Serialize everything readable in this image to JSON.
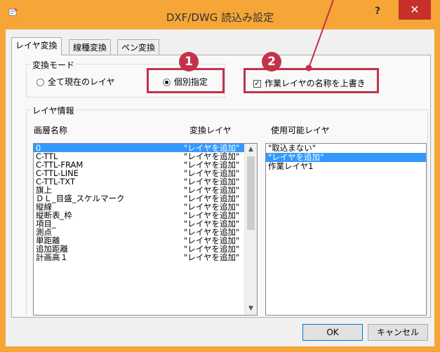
{
  "window": {
    "title": "DXF/DWG 読込み設定",
    "help_label": "?",
    "close_label": "✕",
    "accent_color": "#f5a637"
  },
  "tabs": [
    {
      "label": "レイヤ変換",
      "active": true
    },
    {
      "label": "線種変換",
      "active": false
    },
    {
      "label": "ペン変換",
      "active": false
    }
  ],
  "conversion_mode": {
    "title": "変換モード",
    "options": [
      {
        "label": "全て現在のレイヤ",
        "checked": false
      },
      {
        "label": "個別指定",
        "checked": true
      }
    ]
  },
  "overwrite_option": {
    "label": "作業レイヤの名称を上書き",
    "checked": true
  },
  "markers": [
    "1",
    "2"
  ],
  "layer_info": {
    "title": "レイヤ情報",
    "col_layer_name": "画層名称",
    "col_convert_layer": "変換レイヤ",
    "col_available_layer": "使用可能レイヤ",
    "rows": [
      {
        "name": "0",
        "convert": "\"レイヤを追加\"",
        "selected": true
      },
      {
        "name": "C-TTL",
        "convert": "\"レイヤを追加\""
      },
      {
        "name": "C-TTL-FRAM",
        "convert": "\"レイヤを追加\""
      },
      {
        "name": "C-TTL-LINE",
        "convert": "\"レイヤを追加\""
      },
      {
        "name": "C-TTL-TXT",
        "convert": "\"レイヤを追加\""
      },
      {
        "name": "旗上",
        "convert": "\"レイヤを追加\""
      },
      {
        "name": "ＤＬ_目盛_スケルマーク",
        "convert": "\"レイヤを追加\""
      },
      {
        "name": "縦線",
        "convert": "\"レイヤを追加\""
      },
      {
        "name": "縦断表_枠",
        "convert": "\"レイヤを追加\""
      },
      {
        "name": "項目_",
        "convert": "\"レイヤを追加\""
      },
      {
        "name": "測点",
        "convert": "\"レイヤを追加\""
      },
      {
        "name": "単距離",
        "convert": "\"レイヤを追加\""
      },
      {
        "name": "追加距離",
        "convert": "\"レイヤを追加\""
      },
      {
        "name": "計画高１",
        "convert": "\"レイヤを追加\""
      }
    ],
    "available_layers": [
      {
        "label": "\"取込まない\"",
        "selected": false
      },
      {
        "label": "\"レイヤを追加\"",
        "selected": true
      },
      {
        "label": "作業レイヤ1",
        "selected": false
      }
    ]
  },
  "buttons": {
    "ok": "OK",
    "cancel": "キャンセル"
  },
  "highlight_color": "#c2334a"
}
